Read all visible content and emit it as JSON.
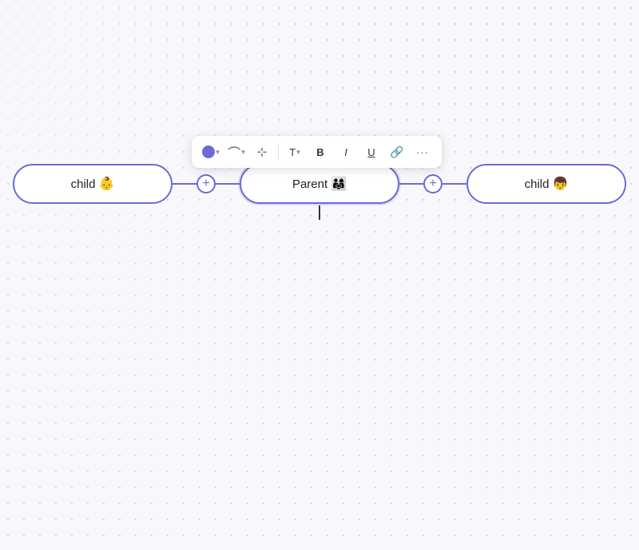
{
  "canvas": {
    "background": "#f8f8fc",
    "grid_color": "#c8c8d8"
  },
  "toolbar": {
    "color_dot": "#6b6bd4",
    "items": [
      {
        "id": "color",
        "label": "●",
        "type": "color",
        "has_arrow": true
      },
      {
        "id": "line-style",
        "label": "⌒",
        "type": "icon",
        "has_arrow": true
      },
      {
        "id": "align",
        "label": "⊹",
        "type": "icon",
        "has_arrow": false
      },
      {
        "id": "text",
        "label": "T",
        "type": "text-label",
        "has_arrow": true
      },
      {
        "id": "bold",
        "label": "B",
        "type": "bold"
      },
      {
        "id": "italic",
        "label": "I",
        "type": "italic"
      },
      {
        "id": "underline",
        "label": "U",
        "type": "underline"
      },
      {
        "id": "link",
        "label": "🔗",
        "type": "icon"
      },
      {
        "id": "more",
        "label": "···",
        "type": "icon"
      }
    ]
  },
  "nodes": {
    "left": {
      "label": "child",
      "emoji": "👶"
    },
    "center": {
      "label": "Parent",
      "emoji": "👨‍👩‍👧"
    },
    "right": {
      "label": "child",
      "emoji": "👦"
    }
  },
  "add_button_label": "+"
}
